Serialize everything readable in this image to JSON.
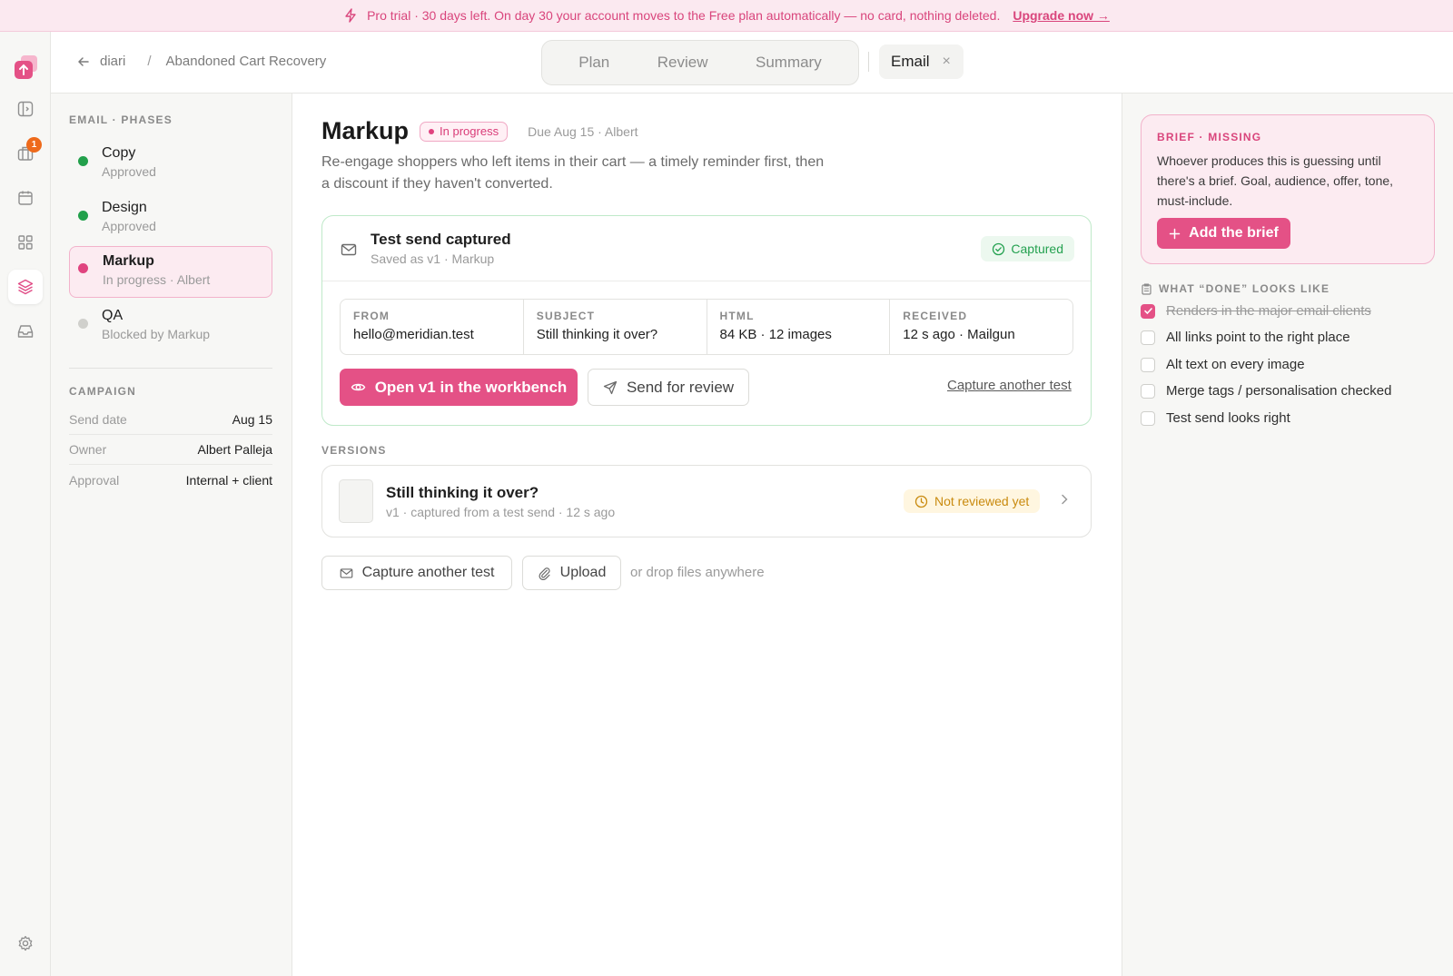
{
  "banner": {
    "text": "Pro trial · 30 days left. On day 30 your account moves to the Free plan automatically — no card, nothing deleted.",
    "link": "Upgrade now →"
  },
  "rail": {
    "badge_count": "1"
  },
  "breadcrumb": {
    "workspace": "diari",
    "separator": "/",
    "page": "Abandoned Cart Recovery"
  },
  "tabs": [
    "Plan",
    "Review",
    "Summary"
  ],
  "open_tab": {
    "label": "Email",
    "close": "×"
  },
  "left": {
    "section_label": "EMAIL · PHASES",
    "phases": [
      {
        "name": "Copy",
        "status": "Approved",
        "color": "#22a04b"
      },
      {
        "name": "Design",
        "status": "Approved",
        "color": "#22a04b"
      },
      {
        "name": "Markup",
        "status": "In progress · Albert",
        "color": "#e0437f"
      },
      {
        "name": "QA",
        "status": "Blocked by Markup",
        "color": "#d0d0cc"
      }
    ],
    "campaign_label": "CAMPAIGN",
    "campaign": [
      {
        "key": "Send date",
        "value": "Aug 15"
      },
      {
        "key": "Owner",
        "value": "Albert Palleja"
      },
      {
        "key": "Approval",
        "value": "Internal + client"
      }
    ]
  },
  "main": {
    "title": "Markup",
    "status_pill": "In progress",
    "meta": "Due Aug 15 · Albert",
    "description": "Re-engage shoppers who left items in their cart — a timely reminder first, then a discount if they haven't converted.",
    "capture": {
      "title": "Test send captured",
      "subtitle": "Saved as v1 · Markup",
      "badge": "Captured",
      "fields": [
        {
          "label": "FROM",
          "value": "hello@meridian.test"
        },
        {
          "label": "SUBJECT",
          "value": "Still thinking it over?"
        },
        {
          "label": "HTML",
          "value": "84 KB · 12 images"
        },
        {
          "label": "RECEIVED",
          "value": "12 s ago · Mailgun"
        }
      ],
      "primary_button": "Open v1 in the workbench",
      "secondary_button": "Send for review",
      "link": "Capture another test"
    },
    "versions_label": "VERSIONS",
    "version": {
      "title": "Still thinking it over?",
      "subtitle": "v1 · captured from a test send · 12 s ago",
      "badge": "Not reviewed yet"
    },
    "actions": {
      "capture": "Capture another test",
      "upload": "Upload",
      "drop_hint": "or drop files anywhere"
    }
  },
  "right": {
    "brief_label": "BRIEF · MISSING",
    "brief_text": "Whoever produces this is guessing until there's a brief. Goal, audience, offer, tone, must-include.",
    "brief_button": "Add the brief",
    "done_label": "WHAT “DONE” LOOKS LIKE",
    "checklist": [
      {
        "label": "Renders in the major email clients",
        "checked": true
      },
      {
        "label": "All links point to the right place",
        "checked": false
      },
      {
        "label": "Alt text on every image",
        "checked": false
      },
      {
        "label": "Merge tags / personalisation checked",
        "checked": false
      },
      {
        "label": "Test send looks right",
        "checked": false
      }
    ]
  },
  "colors": {
    "accent": "#e45186",
    "success": "#22a04b",
    "warning": "#c98a0e"
  }
}
